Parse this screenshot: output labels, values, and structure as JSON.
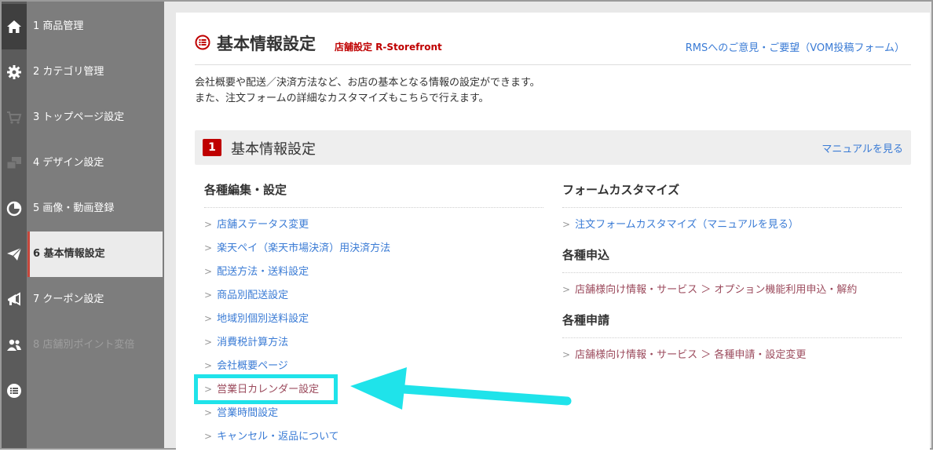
{
  "sidebar": {
    "items": [
      {
        "icon": "home-icon",
        "label": "1  商品管理"
      },
      {
        "icon": "gear-icon",
        "label": "2  カテゴリ管理"
      },
      {
        "icon": "cart-icon",
        "label": "3  トップページ設定"
      },
      {
        "icon": "design-icon",
        "label": "4  デザイン設定"
      },
      {
        "icon": "pie-chart-icon",
        "label": "5  画像・動画登録"
      },
      {
        "icon": "paper-plane-icon",
        "label": "6  基本情報設定"
      },
      {
        "icon": "megaphone-icon",
        "label": "7  クーポン設定"
      },
      {
        "icon": "users-icon",
        "label": "8  店舗別ポイント変倍"
      },
      {
        "icon": "list-icon",
        "label": ""
      }
    ]
  },
  "header": {
    "title": "基本情報設定",
    "subtitle": "店舗設定 R-Storefront",
    "feedback_link": "RMSへのご意見・ご要望（VOM投稿フォーム）"
  },
  "description": {
    "line1": "会社概要や配送／決済方法など、お店の基本となる情報の設定ができます。",
    "line2": "また、注文フォームの詳細なカスタマイズもこちらで行えます。"
  },
  "section": {
    "number": "1",
    "title": "基本情報設定",
    "manual_link": "マニュアルを見る"
  },
  "left_column": {
    "heading": "各種編集・設定",
    "links": [
      "店舗ステータス変更",
      "楽天ペイ（楽天市場決済）用決済方法",
      "配送方法・送料設定",
      "商品別配送設定",
      "地域別個別送料設定",
      "消費税計算方法",
      "会社概要ページ",
      "営業日カレンダー設定",
      "営業時間設定",
      "キャンセル・返品について"
    ]
  },
  "right_column": {
    "form_heading": "フォームカスタマイズ",
    "form_link": "注文フォームカスタマイズ（マニュアルを見る）",
    "apply_heading": "各種申込",
    "apply_link": "店舗様向け情報・サービス ＞ オプション機能利用申込・解約",
    "request_heading": "各種申請",
    "request_link": "店舗様向け情報・サービス ＞ 各種申請・設定変更"
  },
  "colors": {
    "accent_red": "#bf0000",
    "link_blue": "#3a7bd5",
    "highlight_cyan": "#1fe3ea"
  }
}
